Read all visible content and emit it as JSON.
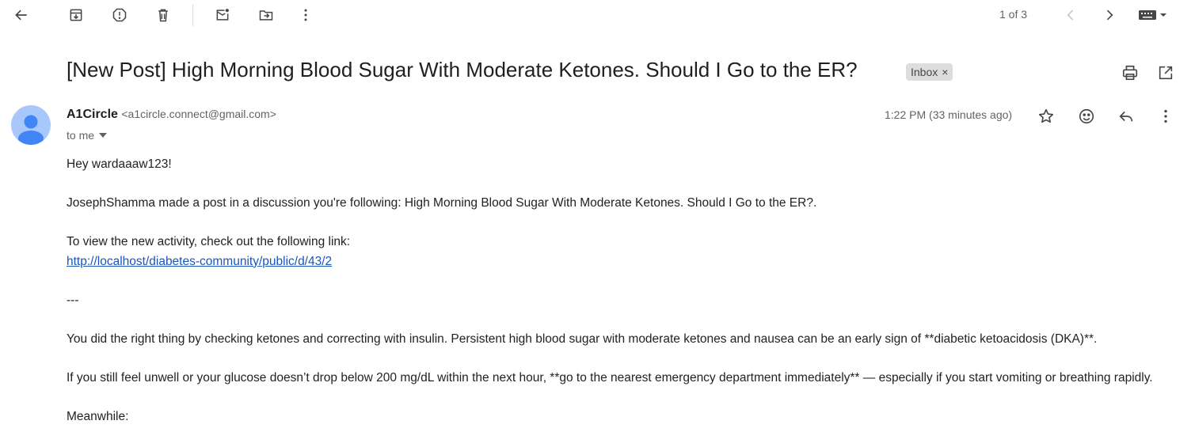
{
  "toolbar": {
    "icons": [
      "back-arrow-icon",
      "archive-icon",
      "report-spam-icon",
      "delete-icon",
      "mark-unread-icon",
      "move-to-icon",
      "more-vert-icon"
    ],
    "pager_text": "1 of 3"
  },
  "subject": "[New Post] High Morning Blood Sugar With Moderate Ketones. Should I Go to the ER?",
  "label": {
    "name": "Inbox",
    "remove": "×"
  },
  "sender": {
    "name": "A1Circle",
    "email": "<a1circle.connect@gmail.com>",
    "to": "to me",
    "time": "1:22 PM (33 minutes ago)",
    "avatar_color": "#a8c7fa",
    "avatar_figure_color": "#4285f4"
  },
  "body": {
    "greeting": "Hey wardaaaw123!",
    "intro": "JosephShamma made a post in a discussion you're following: High Morning Blood Sugar With Moderate Ketones. Should I Go to the ER?.",
    "view_text": "To view the new activity, check out the following link:",
    "link": "http://localhost/diabetes-community/public/d/43/2",
    "separator": "---",
    "para1": "You did the right thing by checking ketones and correcting with insulin. Persistent high blood sugar with moderate ketones and nausea can be an early sign of **diabetic ketoacidosis (DKA)**.",
    "para2": "If you still feel unwell or your glucose doesn’t drop below 200 mg/dL within the next hour, **go to the nearest emergency department immediately** — especially if you start vomiting or breathing rapidly.",
    "para3": "Meanwhile:"
  },
  "colors": {
    "link": "#1a55b8",
    "icon": "#444746",
    "chip_bg": "#dddddd"
  }
}
